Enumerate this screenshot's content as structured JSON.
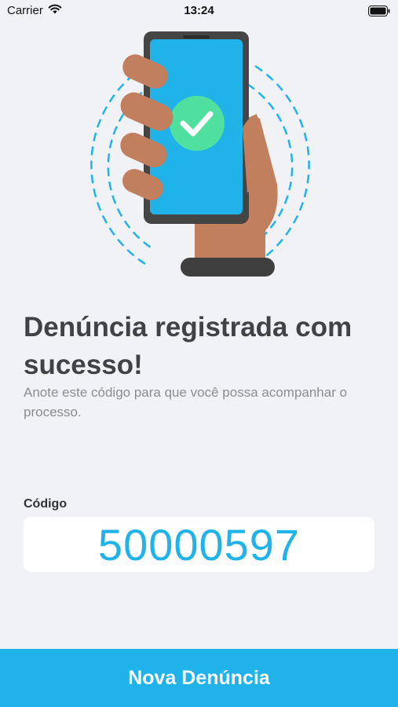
{
  "status_bar": {
    "carrier": "Carrier",
    "time": "13:24",
    "icons": [
      "wifi-icon",
      "battery-icon"
    ]
  },
  "illustration": {
    "description_icon": "phone-in-hand-success-illustration",
    "check_color": "#4fe0a0",
    "screen_color": "#1fb3ea"
  },
  "main": {
    "title": "Denúncia registrada com sucesso!",
    "subtitle": "Anote este código para que você possa acompanhar o processo."
  },
  "code": {
    "label": "Código",
    "value": "50000597"
  },
  "actions": {
    "new_report_label": "Nova Denúncia"
  },
  "colors": {
    "accent": "#1fb3ea",
    "background": "#f1f2f6",
    "title": "#404244",
    "subtitle": "#8b8d92"
  }
}
